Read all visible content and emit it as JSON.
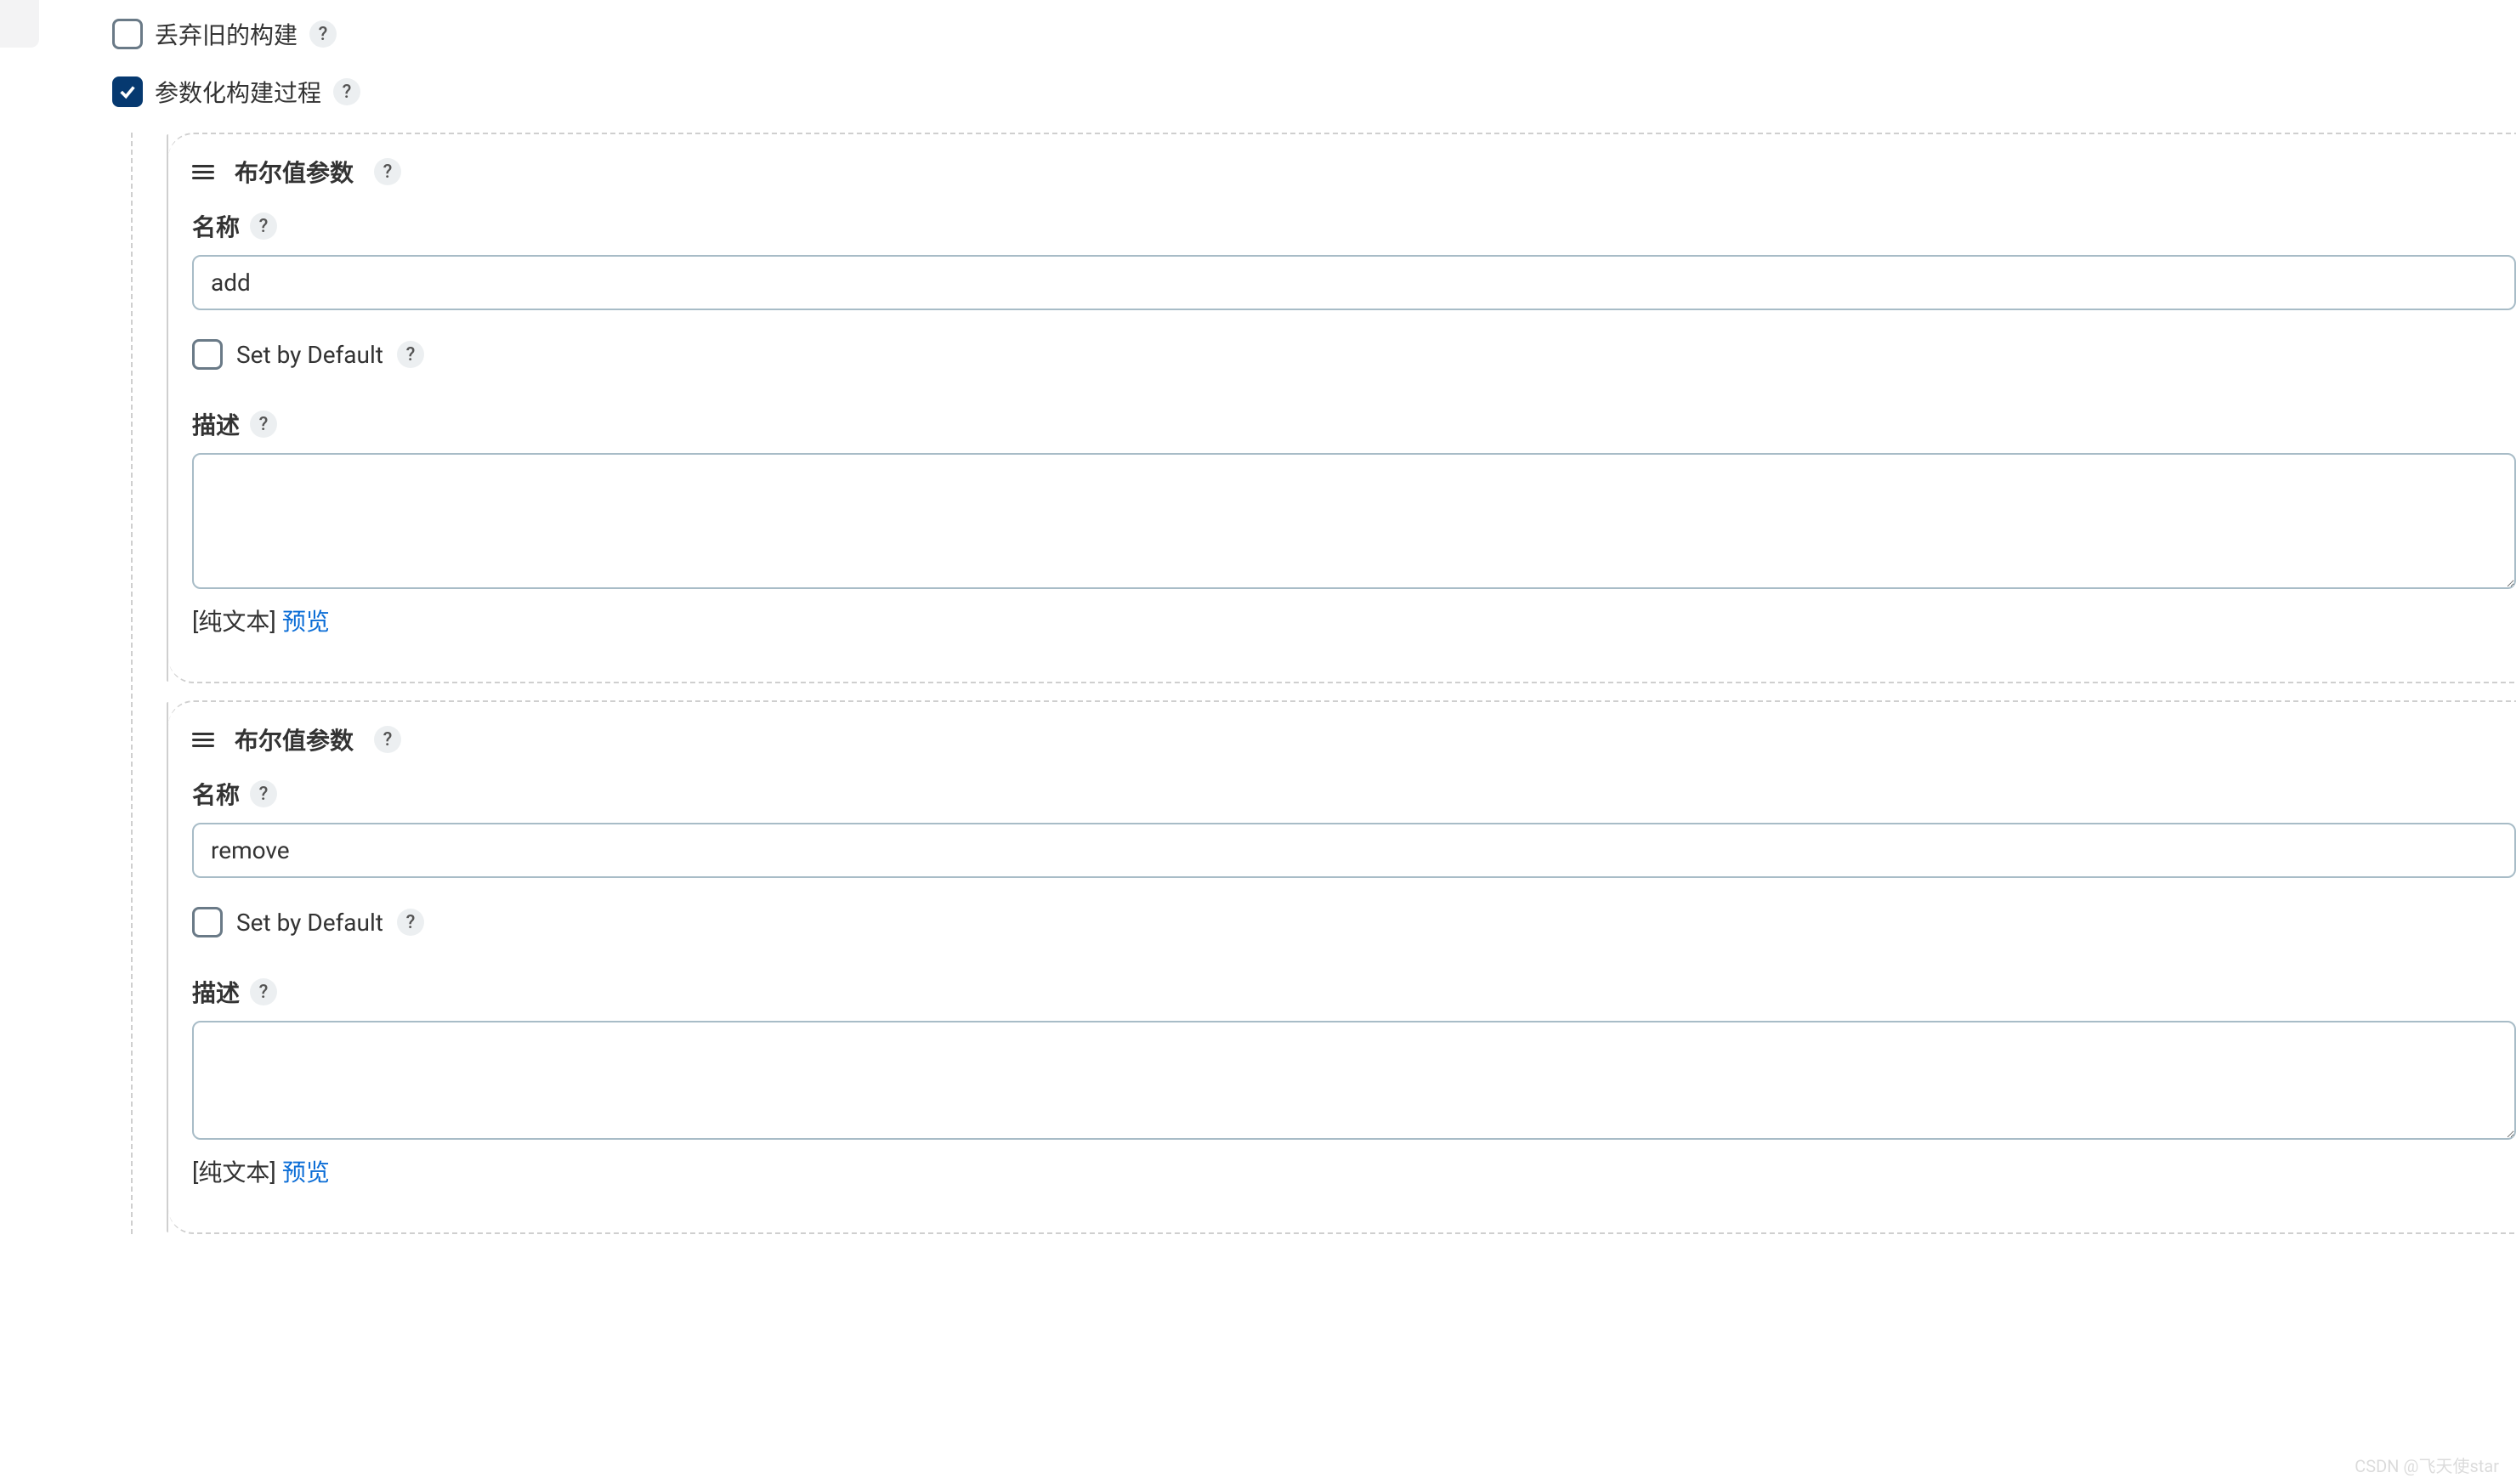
{
  "options": {
    "discard_old": {
      "label": "丢弃旧的构建",
      "checked": false
    },
    "parameterized": {
      "label": "参数化构建过程",
      "checked": true
    }
  },
  "parameters": [
    {
      "type_label": "布尔值参数",
      "name_label": "名称",
      "name_value": "add",
      "set_by_default_label": "Set by Default",
      "set_by_default_checked": false,
      "desc_label": "描述",
      "desc_value": "",
      "plain_text_label": "[纯文本]",
      "preview_label": "预览"
    },
    {
      "type_label": "布尔值参数",
      "name_label": "名称",
      "name_value": "remove",
      "set_by_default_label": "Set by Default",
      "set_by_default_checked": false,
      "desc_label": "描述",
      "desc_value": "",
      "plain_text_label": "[纯文本]",
      "preview_label": "预览"
    }
  ],
  "help_char": "?",
  "watermark": "CSDN @飞天使star"
}
